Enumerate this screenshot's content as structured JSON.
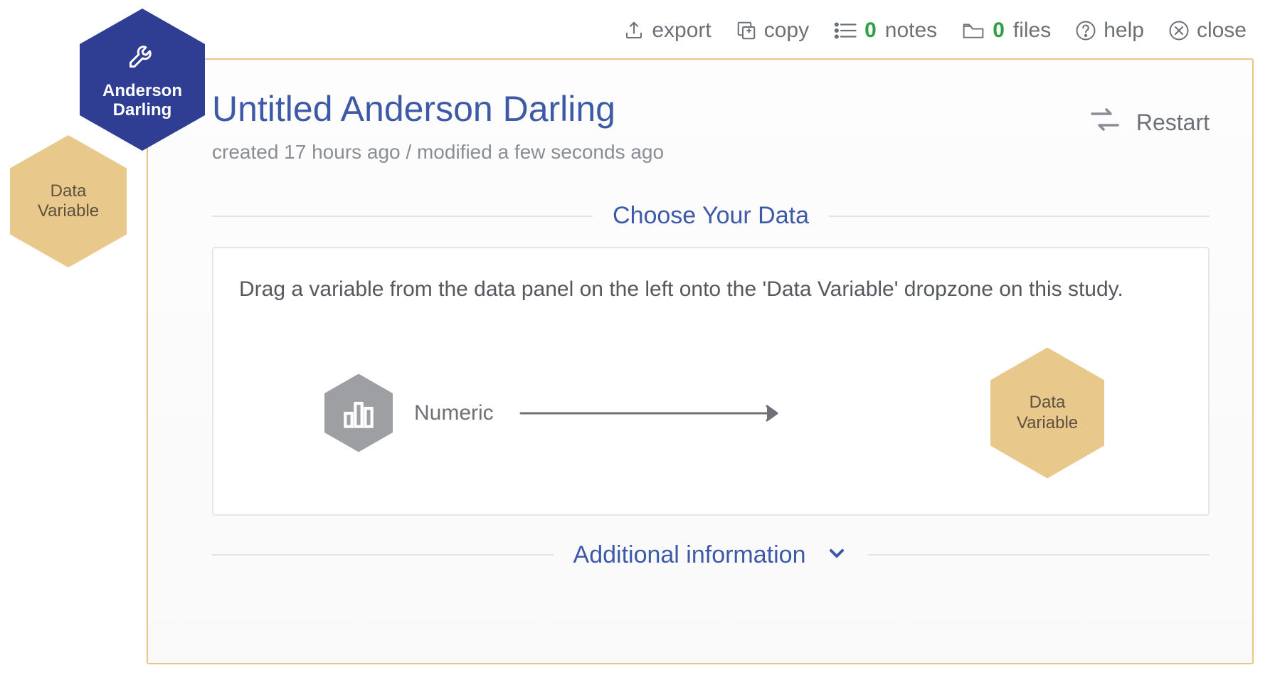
{
  "toolbar": {
    "export": "export",
    "copy": "copy",
    "notes_count": "0",
    "notes": "notes",
    "files_count": "0",
    "files": "files",
    "help": "help",
    "close": "close"
  },
  "badges": {
    "primary_line1": "Anderson",
    "primary_line2": "Darling",
    "secondary_line1": "Data",
    "secondary_line2": "Variable"
  },
  "header": {
    "title": "Untitled Anderson Darling",
    "meta": "created 17 hours ago / modified a few seconds ago",
    "restart": "Restart"
  },
  "sections": {
    "choose_data": "Choose Your Data",
    "additional_info": "Additional information"
  },
  "card": {
    "instruction": "Drag a variable from the data panel on the left onto the 'Data Variable' dropzone on this study.",
    "source_label": "Numeric",
    "drop_line1": "Data",
    "drop_line2": "Variable"
  }
}
